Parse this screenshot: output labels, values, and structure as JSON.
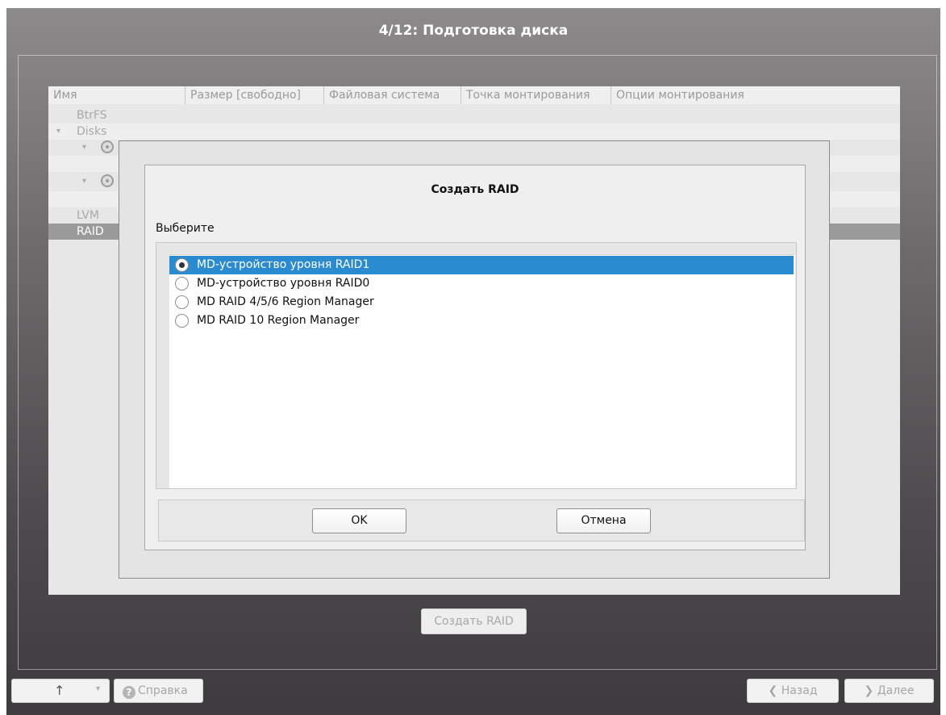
{
  "window": {
    "title": "4/12: Подготовка диска"
  },
  "table": {
    "columns": [
      "Имя",
      "Размер [свободно]",
      "Файловая система",
      "Точка монтирования",
      "Опции монтирования"
    ],
    "rows": {
      "btrfs": "BtrFS",
      "disks": "Disks",
      "lvm": "LVM",
      "raid": "RAID"
    }
  },
  "create_raid_button": "Создать RAID",
  "dialog": {
    "title": "Создать RAID",
    "prompt": "Выберите",
    "options": [
      {
        "label": "MD-устройство уровня RAID1",
        "selected": true
      },
      {
        "label": "MD-устройство уровня RAID0",
        "selected": false
      },
      {
        "label": "MD RAID 4/5/6 Region Manager",
        "selected": false
      },
      {
        "label": "MD RAID 10 Region Manager",
        "selected": false
      }
    ],
    "ok_label": "OK",
    "cancel_label": "Отмена"
  },
  "bottom_bar": {
    "up_icon": "↑",
    "help_label": "Справка",
    "back_label": "Назад",
    "next_label": "Далее"
  },
  "colors": {
    "selection": "#2b8bd0",
    "window_bg_top": "#8d8a8c",
    "window_bg_bottom": "#3e3b3e"
  }
}
